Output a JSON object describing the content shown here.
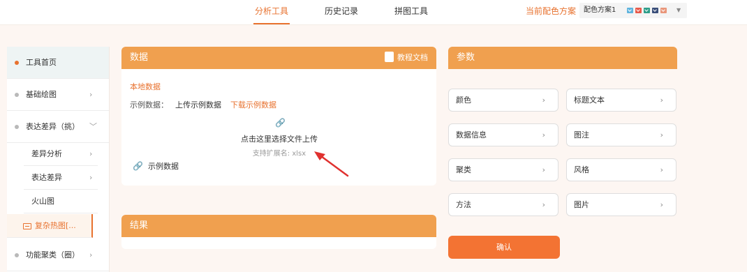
{
  "nav": {
    "tabs": [
      {
        "label": "分析工具"
      },
      {
        "label": "历史记录"
      },
      {
        "label": "拼图工具"
      }
    ],
    "scheme_label": "当前配色方案",
    "scheme_value": "配色方案1",
    "scheme_colors": [
      "#5fb4de",
      "#e8594a",
      "#2f9e8a",
      "#3a4f7a",
      "#e9967a"
    ]
  },
  "sidebar": {
    "items": [
      {
        "label": "工具首页"
      },
      {
        "label": "基础绘图",
        "chevron": "›"
      },
      {
        "label": "表达差异（挑）",
        "chevron": "﹀"
      },
      {
        "label": "功能聚类（圈）",
        "chevron": "›"
      }
    ],
    "sub_items": [
      {
        "label": "差异分析",
        "chevron": "›"
      },
      {
        "label": "表达差异",
        "chevron": "›"
      },
      {
        "label": "火山图",
        "chevron": ""
      },
      {
        "label": "复杂热图[...",
        "chevron": ""
      }
    ]
  },
  "data_panel": {
    "title": "数据",
    "doc_link": "教程文档",
    "local_data": "本地数据",
    "example_label": "示例数据：",
    "upload_example": "上传示例数据",
    "download_example": "下载示例数据",
    "upload_text": "点击这里选择文件上传",
    "upload_hint": "支持扩展名: xlsx",
    "sample_data": "示例数据"
  },
  "result_panel": {
    "title": "结果"
  },
  "params_panel": {
    "title": "参数",
    "buttons": [
      {
        "label": "颜色"
      },
      {
        "label": "标题文本"
      },
      {
        "label": "数据信息"
      },
      {
        "label": "图注"
      },
      {
        "label": "聚类"
      },
      {
        "label": "风格"
      },
      {
        "label": "方法"
      },
      {
        "label": "图片"
      }
    ],
    "confirm": "确认"
  },
  "icons": {
    "link": "🔗",
    "chevron_right": "›",
    "caret_down": "▼"
  }
}
